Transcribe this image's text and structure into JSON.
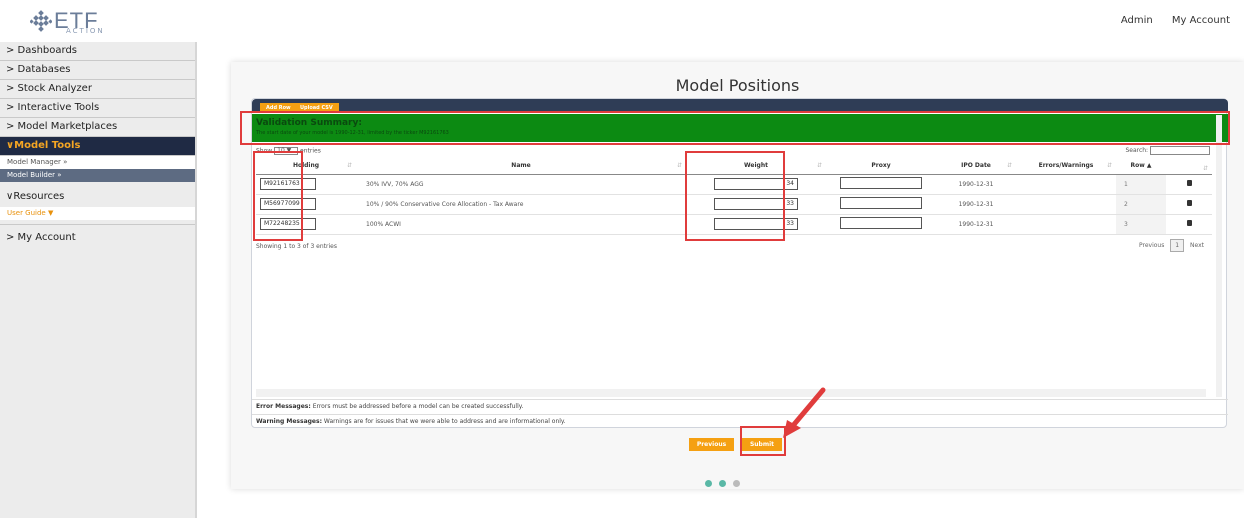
{
  "header": {
    "logo_text": "ETF",
    "logo_sub": "ACTION",
    "admin": "Admin",
    "my_account": "My Account"
  },
  "sidebar": {
    "items": [
      {
        "label": "> Dashboards"
      },
      {
        "label": "> Databases"
      },
      {
        "label": "> Stock Analyzer"
      },
      {
        "label": "> Interactive Tools"
      },
      {
        "label": "> Model Marketplaces"
      }
    ],
    "active": "∨Model Tools",
    "sub_model_manager": "Model Manager »",
    "sub_model_builder": "Model Builder »",
    "resources": "∨Resources",
    "user_guide": "User Guide",
    "my_account": "> My Account"
  },
  "panel": {
    "title": "Model Positions",
    "add_row": "Add Row",
    "upload_csv": "Upload CSV",
    "validation_title": "Validation Summary:",
    "validation_text": "The start date of your model is 1990-12-31, limited by the ticker M92161763",
    "show": "Show",
    "entries_value": "10",
    "entries": "entries",
    "search": "Search:",
    "columns": [
      "Holding",
      "Name",
      "Weight",
      "Proxy",
      "IPO Date",
      "Errors/Warnings",
      "Row"
    ],
    "rows": [
      {
        "holding": "M92161763",
        "name": "30% IVV, 70% AGG",
        "weight": "34",
        "ipo": "1990-12-31",
        "row": "1"
      },
      {
        "holding": "M56977099",
        "name": "10% / 90% Conservative Core Allocation - Tax Aware",
        "weight": "33",
        "ipo": "1990-12-31",
        "row": "2"
      },
      {
        "holding": "M72248235",
        "name": "100% ACWI",
        "weight": "33",
        "ipo": "1990-12-31",
        "row": "3"
      }
    ],
    "showing": "Showing 1 to 3 of 3 entries",
    "previous_page": "Previous",
    "page": "1",
    "next_page": "Next",
    "error_label": "Error Messages:",
    "error_text": "Errors must be addressed before a model can be created successfully.",
    "warning_label": "Warning Messages:",
    "warning_text": "Warnings are for issues that we were able to address and are informational only.",
    "previous_button": "Previous",
    "submit_button": "Submit"
  },
  "colors": {
    "accent": "#f5a012",
    "nav_dark": "#1f2a44",
    "validation_green": "#0c8a12",
    "highlight_red": "#e03c3c"
  }
}
